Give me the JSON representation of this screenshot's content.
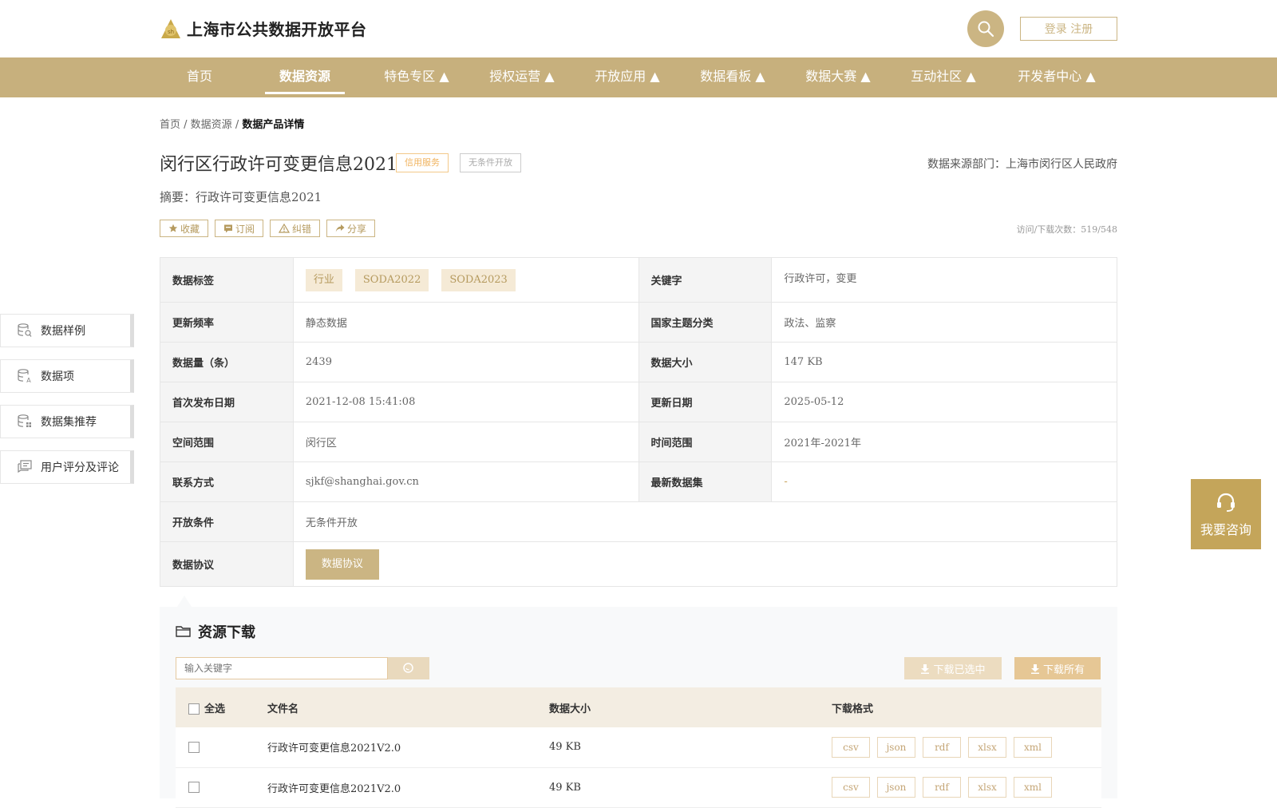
{
  "header": {
    "site_title": "上海市公共数据开放平台",
    "login_label": "登录 注册"
  },
  "nav": {
    "items": [
      {
        "label": "首页"
      },
      {
        "label": "数据资源"
      },
      {
        "label": "特色专区 ▲"
      },
      {
        "label": "授权运营 ▲"
      },
      {
        "label": "开放应用 ▲"
      },
      {
        "label": "数据看板 ▲"
      },
      {
        "label": "数据大赛 ▲"
      },
      {
        "label": "互动社区 ▲"
      },
      {
        "label": "开发者中心 ▲"
      }
    ],
    "active": "数据资源"
  },
  "breadcrumb": {
    "home": "首页",
    "sep1": " / ",
    "resources": "数据资源",
    "sep2": " / ",
    "current": "数据产品详情"
  },
  "dataset": {
    "title": "闵行区行政许可变更信息2021",
    "tag_credit": "信用服务",
    "tag_open": "无条件开放",
    "source": "数据来源部门：上海市闵行区人民政府",
    "summary": "摘要：行政许可变更信息2021",
    "visits": "访问/下载次数：519/548"
  },
  "actions": {
    "favorite": "收藏",
    "subscribe": "订阅",
    "correct": "纠错",
    "share": "分享"
  },
  "info": {
    "tags_label": "数据标签",
    "tags": [
      "行业",
      "SODA2022",
      "SODA2023"
    ],
    "keywords_label": "关键字",
    "keywords": "行政许可，变更",
    "freq_label": "更新频率",
    "freq": "静态数据",
    "theme_label": "国家主题分类",
    "theme": "政法、监察",
    "count_label": "数据量（条）",
    "count": "2439",
    "size_label": "数据大小",
    "size": "147 KB",
    "first_pub_label": "首次发布日期",
    "first_pub": "2021-12-08 15:41:08",
    "updated_label": "更新日期",
    "updated": "2025-05-12",
    "space_label": "空间范围",
    "space": "闵行区",
    "time_label": "时间范围",
    "time": "2021年-2021年",
    "contact_label": "联系方式",
    "contact": "sjkf@shanghai.gov.cn",
    "latest_label": "最新数据集",
    "latest": "-",
    "cond_label": "开放条件",
    "cond": "无条件开放",
    "protocol_label": "数据协议",
    "protocol_btn": "数据协议"
  },
  "sidebar": {
    "items": [
      {
        "label": "数据样例"
      },
      {
        "label": "数据项"
      },
      {
        "label": "数据集推荐"
      },
      {
        "label": "用户评分及评论"
      }
    ]
  },
  "consult": {
    "label": "我要咨询"
  },
  "download": {
    "title": "资源下载",
    "search_placeholder": "输入关键字",
    "download_selected": "下载已选中",
    "download_all": "下载所有",
    "headers": {
      "select_all": "全选",
      "filename": "文件名",
      "size": "数据大小",
      "format": "下载格式"
    },
    "rows": [
      {
        "filename": "行政许可变更信息2021V2.0",
        "size": "49 KB",
        "formats": [
          "csv",
          "json",
          "rdf",
          "xlsx",
          "xml"
        ]
      },
      {
        "filename": "行政许可变更信息2021V2.0",
        "size": "49 KB",
        "formats": [
          "csv",
          "json",
          "rdf",
          "xlsx",
          "xml"
        ]
      }
    ]
  },
  "colors": {
    "brand": "#c7b07d",
    "accent": "#cbb583",
    "credit_tag": "#f0b35e",
    "consult": "#c4a55a"
  }
}
